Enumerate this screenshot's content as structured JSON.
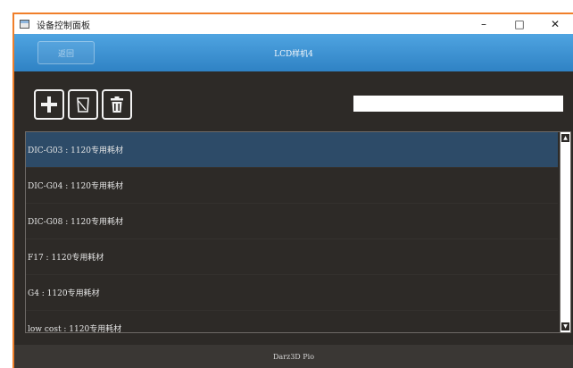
{
  "window": {
    "title": "设备控制面板",
    "minimize_glyph": "–",
    "maximize_glyph": "□",
    "close_glyph": "✕"
  },
  "header": {
    "back_label": "返回",
    "title": "LCD样机4"
  },
  "toolbar": {
    "buttons": [
      {
        "name": "add",
        "icon": "plus-icon"
      },
      {
        "name": "edit",
        "icon": "edit-icon"
      },
      {
        "name": "delete",
        "icon": "trash-icon"
      }
    ]
  },
  "search": {
    "value": "",
    "placeholder": ""
  },
  "materials": {
    "items": [
      {
        "label": "DIC-G03 : 1120专用耗材",
        "selected": true
      },
      {
        "label": "DIC-G04 : 1120专用耗材",
        "selected": false
      },
      {
        "label": "DIC-G08 : 1120专用耗材",
        "selected": false
      },
      {
        "label": "F17 : 1120专用耗材",
        "selected": false
      },
      {
        "label": "G4 : 1120专用耗材",
        "selected": false
      },
      {
        "label": "low cost : 1120专用耗材",
        "selected": false
      }
    ]
  },
  "footer": {
    "text": "Darz3D Pio"
  },
  "colors": {
    "accent_border": "#f07f2a",
    "header_blue": "#3a8fd1",
    "selected_row": "#2d4b68",
    "background": "#2d2a27"
  }
}
